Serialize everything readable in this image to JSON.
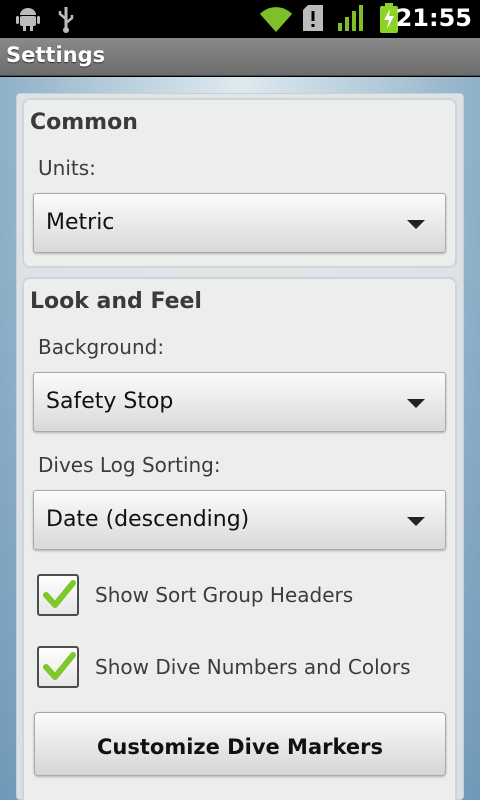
{
  "status_bar": {
    "time": "21:55",
    "icons": [
      "android-debug-icon",
      "usb-icon",
      "wifi-icon",
      "sd-card-alert-icon",
      "signal-icon",
      "battery-charging-icon"
    ]
  },
  "title_bar": {
    "title": "Settings"
  },
  "sections": {
    "common": {
      "title": "Common",
      "units_label": "Units:",
      "units_value": "Metric"
    },
    "look_and_feel": {
      "title": "Look and Feel",
      "background_label": "Background:",
      "background_value": "Safety Stop",
      "sorting_label": "Dives Log Sorting:",
      "sorting_value": "Date (descending)",
      "show_sort_group_headers": {
        "label": "Show Sort Group Headers",
        "checked": true
      },
      "show_dive_numbers": {
        "label": "Show Dive Numbers and Colors",
        "checked": true
      },
      "customize_button": "Customize Dive Markers"
    }
  },
  "colors": {
    "checkmark": "#7ec82a",
    "title_bar": "#7a7a7a",
    "battery": "#8cd227"
  }
}
